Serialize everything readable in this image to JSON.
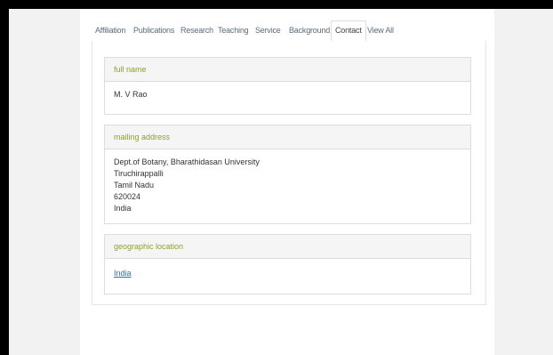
{
  "tabs": [
    {
      "label": "Affiliation",
      "active": false
    },
    {
      "label": "Publications",
      "active": false
    },
    {
      "label": "Research",
      "active": false
    },
    {
      "label": "Teaching",
      "active": false
    },
    {
      "label": "Service",
      "active": false
    },
    {
      "label": "Background",
      "active": false
    },
    {
      "label": "Contact",
      "active": true
    },
    {
      "label": "View All",
      "active": false
    }
  ],
  "full_name": {
    "heading": "full name",
    "value": "M. V Rao"
  },
  "mailing_address": {
    "heading": "mailing address",
    "lines": [
      "Dept.of Botany, Bharathidasan University",
      "Tiruchirappalli",
      "Tamil Nadu",
      "620024",
      "India"
    ]
  },
  "geographic_location": {
    "heading": "geographic location",
    "link": "India"
  },
  "colors": {
    "heading_text": "#8aa12b",
    "link": "#2a6fb0",
    "panel_heading_bg": "#f5f5f5",
    "border": "#dddddd"
  }
}
